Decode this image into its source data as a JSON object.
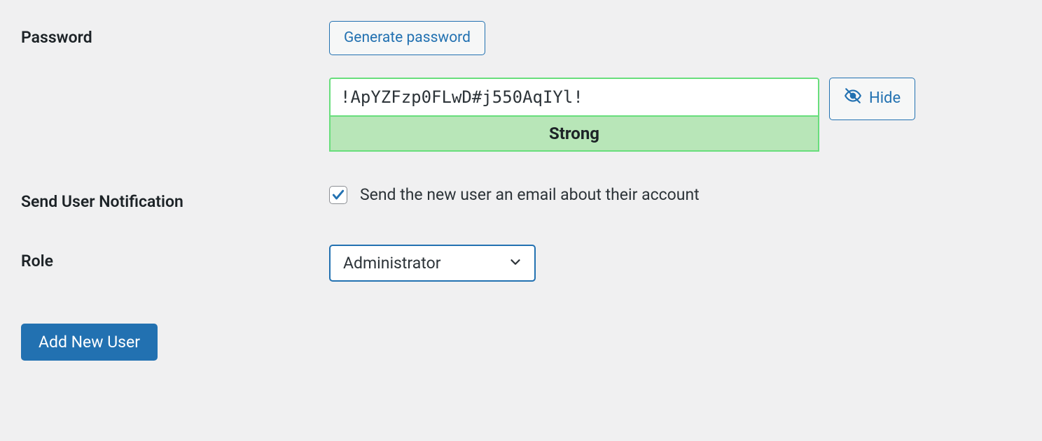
{
  "password": {
    "label": "Password",
    "generate_button": "Generate password",
    "value": "!ApYZFzp0FLwD#j550AqIYl!",
    "strength": "Strong",
    "hide_button": "Hide"
  },
  "notification": {
    "label": "Send User Notification",
    "checkbox_label": "Send the new user an email about their account",
    "checked": true
  },
  "role": {
    "label": "Role",
    "selected": "Administrator"
  },
  "submit": {
    "label": "Add New User"
  },
  "colors": {
    "primary": "#2271b1",
    "strength_bg": "#b8e6b8",
    "strength_border": "#68de7c"
  }
}
